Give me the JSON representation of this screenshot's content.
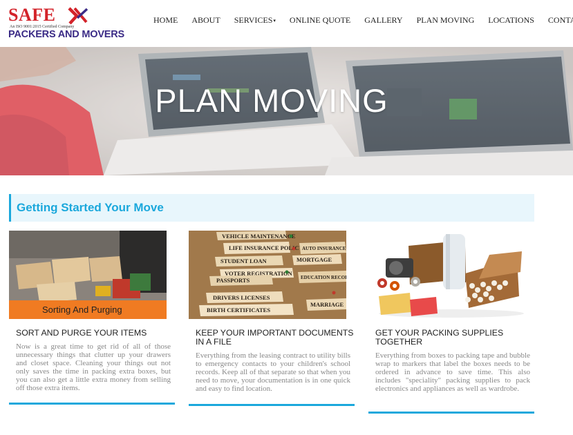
{
  "brand": {
    "name_top": "SAFE",
    "certification": "An ISO 9001:2015 Certified Company",
    "name_bottom": "PACKERS AND MOVERS",
    "colors": {
      "red": "#d3232a",
      "navy": "#3b2b86"
    }
  },
  "nav": {
    "items": [
      {
        "label": "HOME"
      },
      {
        "label": "ABOUT"
      },
      {
        "label": "SERVICES"
      },
      {
        "label": "ONLINE QUOTE"
      },
      {
        "label": "GALLERY"
      },
      {
        "label": "PLAN MOVING"
      },
      {
        "label": "LOCATIONS"
      },
      {
        "label": "CONTACT"
      }
    ]
  },
  "hero": {
    "title": "PLAN MOVING"
  },
  "section": {
    "heading": "Getting Started Your Move",
    "accent": "#1ba8dc"
  },
  "cards": [
    {
      "image_label": "Sorting And Purging",
      "title": "SORT AND PURGE YOUR ITEMS",
      "text": "Now is a great time to get rid of all of those unnecessary things that clutter up your drawers and closet space. Cleaning your things out not only saves the time in packing extra boxes, but you can also get a little extra money from selling off those extra items."
    },
    {
      "folder_labels": [
        "VEHICLE MAINTENANCE",
        "LIFE INSURANCE POLICY",
        "STUDENT LOAN",
        "VOTER REGISTRATION",
        "PASSPORTS",
        "DRIVERS LICENSES",
        "BIRTH CERTIFICATES",
        "AUTO INSURANCE",
        "MORTGAGE",
        "EDUCATION RECORDS",
        "MARRIAGE"
      ],
      "title": "KEEP YOUR IMPORTANT DOCUMENTS IN A FILE",
      "text": "Everything from the leasing contract to utility bills to emergency contacts to your children's school records. Keep all of that separate so that when you need to move, your documentation is in one quick and easy to find location."
    },
    {
      "title": "GET YOUR PACKING SUPPLIES TOGETHER",
      "text": "Everything from boxes to packing tape and bubble wrap to markers that label the boxes needs to be ordered in advance to save time. This also includes \"speciality\" packing supplies to pack electronics and appliances as well as wardrobe."
    }
  ]
}
